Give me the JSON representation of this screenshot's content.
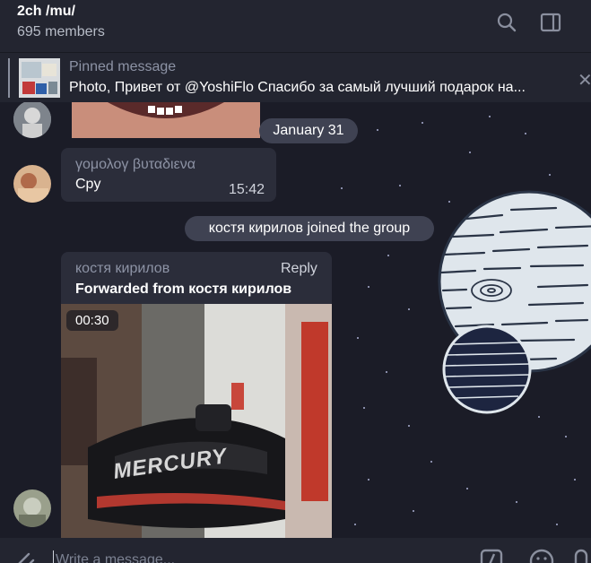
{
  "header": {
    "title": "2ch /mu/",
    "members": "695 members",
    "icons": [
      "search-icon",
      "sidebar-toggle-icon"
    ]
  },
  "pinned": {
    "title": "Pinned message",
    "text": "Photo, Привет от @YoshiFlo  Спасибо за  самый лучший подарок на..."
  },
  "chat": {
    "date_separator": "January 31",
    "messages": [
      {
        "sender": "γομολογ βυταδιενα",
        "text": "Cpy",
        "time": "15:42"
      }
    ],
    "service_message": "костя кирилов joined the group",
    "forwarded": {
      "sender": "костя кирилов",
      "reply_label": "Reply",
      "forwarded_label": "Forwarded from костя кирилов",
      "video_duration": "00:30",
      "video_brand": "MERCURY"
    }
  },
  "composer": {
    "placeholder": "Write a message...",
    "icons": [
      "attach-icon",
      "commands-icon",
      "emoji-icon",
      "microphone-icon"
    ]
  },
  "colors": {
    "background": "#1b1c27",
    "header": "#232530",
    "bubble": "#2b2d3a",
    "accent_name": "#8d93a5"
  }
}
